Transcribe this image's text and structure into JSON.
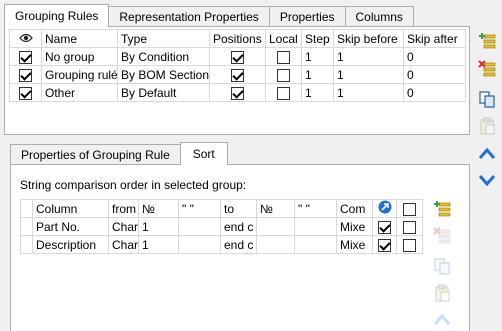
{
  "top_tabs": [
    "Grouping Rules",
    "Representation Properties",
    "Properties",
    "Columns"
  ],
  "rules_table": {
    "headers": [
      "",
      "Name",
      "Type",
      "Positions",
      "Local",
      "Step",
      "Skip before",
      "Skip after"
    ],
    "rows": [
      {
        "visible": true,
        "name": "No group",
        "type": "By Condition",
        "positions": true,
        "local": false,
        "step": "1",
        "skip_before": "1",
        "skip_after": "0"
      },
      {
        "visible": true,
        "name": "Grouping rulé",
        "type": "By BOM Section",
        "positions": true,
        "local": false,
        "step": "1",
        "skip_before": "1",
        "skip_after": "0"
      },
      {
        "visible": true,
        "name": "Other",
        "type": "By Default",
        "positions": true,
        "local": false,
        "step": "1",
        "skip_before": "1",
        "skip_after": "0"
      }
    ]
  },
  "bottom_tabs": [
    "Properties of Grouping Rule",
    "Sort"
  ],
  "sort_label": "String comparison order in selected group:",
  "sort_table": {
    "headers": [
      "",
      "Column",
      "from",
      "№",
      "\" \"",
      "to",
      "№",
      "\" \"",
      "Com",
      "",
      ""
    ],
    "rows": [
      {
        "column": "Part No.",
        "from": "Chara",
        "n1": "1",
        "q1": "",
        "to": "end c",
        "n2": "",
        "q2": "",
        "com": "Mixe",
        "check1": true,
        "check2": false
      },
      {
        "column": "Description",
        "from": "Chara",
        "n1": "1",
        "q1": "",
        "to": "end c",
        "n2": "",
        "q2": "",
        "com": "Mixe",
        "check1": true,
        "check2": false
      }
    ]
  },
  "colors": {
    "accent_blue": "#1e6fd9",
    "add_green": "#3ca03c",
    "delete_red": "#d03030",
    "list_yellow": "#e8c020"
  }
}
